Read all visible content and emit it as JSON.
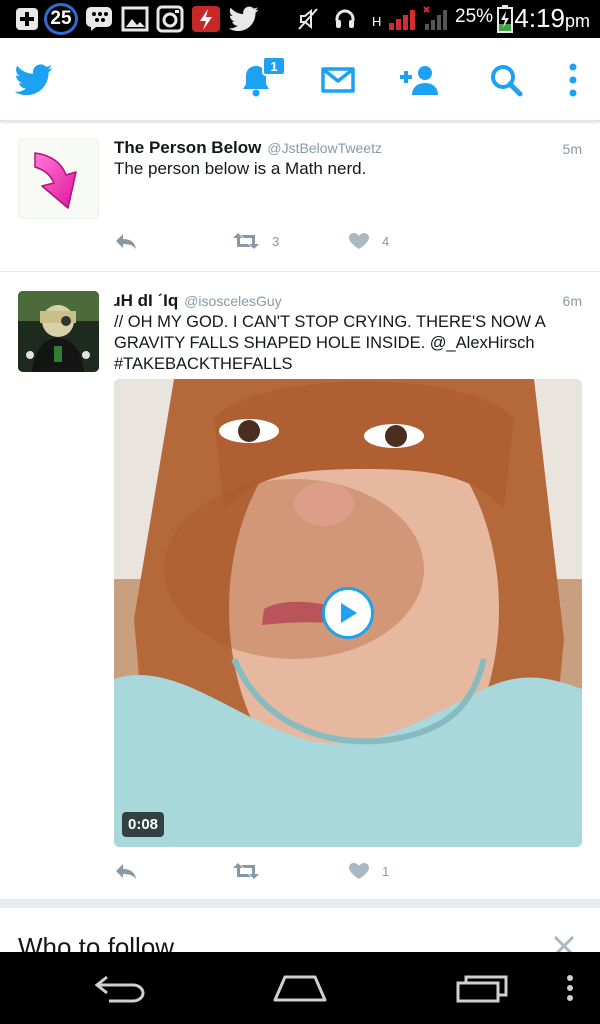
{
  "status_bar": {
    "notification_count": "25",
    "network_label": "H",
    "battery": "25%",
    "time": "4:19",
    "time_suffix": "pm"
  },
  "app_bar": {
    "notification_badge": "1",
    "accent": "#1da1f2"
  },
  "tweets": [
    {
      "name": "The Person Below",
      "handle": "@JstBelowTweetz",
      "time": "5m",
      "text": "The person below is a Math nerd.",
      "retweets": "3",
      "likes": "4"
    },
    {
      "name": "ɹH dI ˊIq",
      "handle": "@isoscelesGuy",
      "time": "6m",
      "text": "// OH MY GOD. I CAN'T STOP CRYING. THERE'S NOW A GRAVITY FALLS SHAPED HOLE INSIDE. @_AlexHirsch #TAKEBACKTHEFALLS",
      "video_duration": "0:08",
      "retweets": "",
      "likes": "1"
    }
  ],
  "who_to_follow": {
    "title": "Who to follow"
  }
}
